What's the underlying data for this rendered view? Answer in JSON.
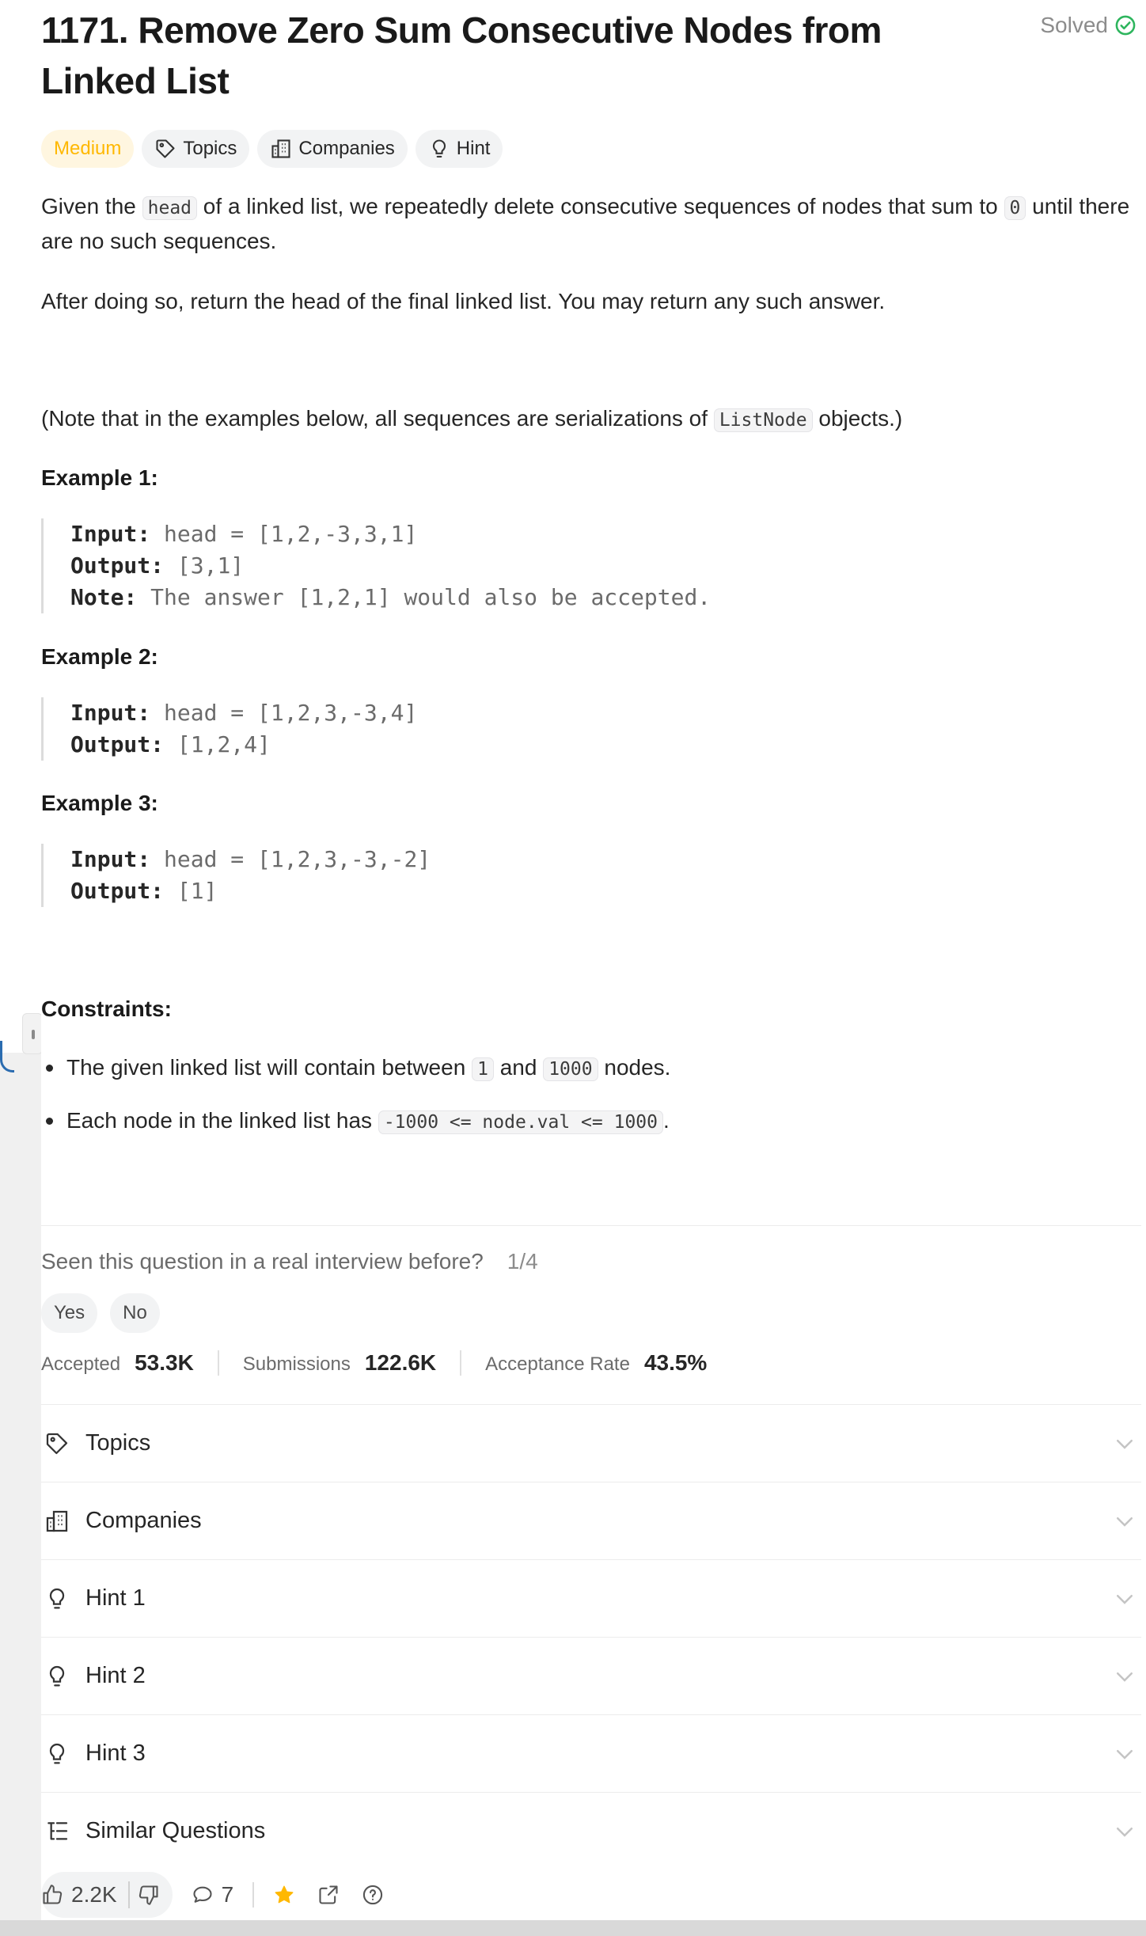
{
  "problem": {
    "number_title": "1171. Remove Zero Sum Consecutive Nodes from Linked List",
    "status": "Solved"
  },
  "chips": {
    "difficulty": "Medium",
    "topics": "Topics",
    "companies": "Companies",
    "hint": "Hint"
  },
  "description": {
    "p1_a": "Given the ",
    "p1_code1": "head",
    "p1_b": " of a linked list, we repeatedly delete consecutive sequences of nodes that sum to ",
    "p1_code2": "0",
    "p1_c": " until there are no such sequences.",
    "p2": "After doing so, return the head of the final linked list.  You may return any such answer.",
    "p3_a": "(Note that in the examples below, all sequences are serializations of ",
    "p3_code": "ListNode",
    "p3_b": " objects.)"
  },
  "examples": [
    {
      "heading": "Example 1:",
      "input_label": "Input:",
      "input": " head = [1,2,-3,3,1]",
      "output_label": "Output:",
      "output": " [3,1]",
      "note_label": "Note:",
      "note": " The answer [1,2,1] would also be accepted."
    },
    {
      "heading": "Example 2:",
      "input_label": "Input:",
      "input": " head = [1,2,3,-3,4]",
      "output_label": "Output:",
      "output": " [1,2,4]"
    },
    {
      "heading": "Example 3:",
      "input_label": "Input:",
      "input": " head = [1,2,3,-3,-2]",
      "output_label": "Output:",
      "output": " [1]"
    }
  ],
  "constraints": {
    "heading": "Constraints:",
    "c1_a": "The given linked list will contain between ",
    "c1_code1": "1",
    "c1_b": " and ",
    "c1_code2": "1000",
    "c1_c": " nodes.",
    "c2_a": "Each node in the linked list has ",
    "c2_code": "-1000 <= node.val <= 1000",
    "c2_b": "."
  },
  "interview": {
    "question": "Seen this question in a real interview before?",
    "counter": "1/4",
    "yes": "Yes",
    "no": "No"
  },
  "stats": {
    "accepted_label": "Accepted",
    "accepted_value": "53.3K",
    "submissions_label": "Submissions",
    "submissions_value": "122.6K",
    "rate_label": "Acceptance Rate",
    "rate_value": "43.5%"
  },
  "accordion": [
    {
      "label": "Topics",
      "icon": "tag-icon"
    },
    {
      "label": "Companies",
      "icon": "building-icon"
    },
    {
      "label": "Hint 1",
      "icon": "lightbulb-icon"
    },
    {
      "label": "Hint 2",
      "icon": "lightbulb-icon"
    },
    {
      "label": "Hint 3",
      "icon": "lightbulb-icon"
    },
    {
      "label": "Similar Questions",
      "icon": "list-tree-icon"
    }
  ],
  "toolbar": {
    "likes": "2.2K",
    "comments": "7",
    "star_color": "#ffb800"
  },
  "colors": {
    "solved_check": "#2db55d",
    "medium": "#ffb800"
  }
}
